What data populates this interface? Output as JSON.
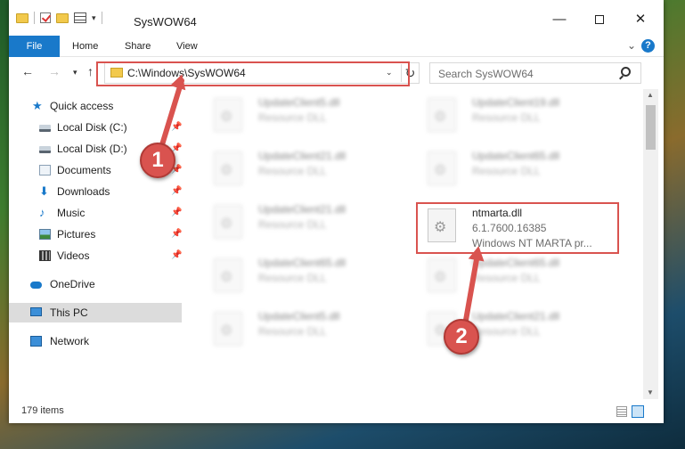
{
  "window": {
    "title": "SysWOW64",
    "controls": {
      "minimize": "—",
      "maximize": "",
      "close": "✕"
    }
  },
  "ribbon": {
    "tabs": [
      "File",
      "Home",
      "Share",
      "View"
    ],
    "help": "?"
  },
  "navigation": {
    "address_path": "C:\\Windows\\SysWOW64",
    "search_placeholder": "Search SysWOW64"
  },
  "sidebar": {
    "items": [
      {
        "label": "Quick access",
        "icon": "star-icon"
      },
      {
        "label": "Local Disk (C:)",
        "icon": "drive-icon",
        "pinned": true
      },
      {
        "label": "Local Disk (D:)",
        "icon": "drive-icon",
        "pinned": true
      },
      {
        "label": "Documents",
        "icon": "documents-icon",
        "pinned": true
      },
      {
        "label": "Downloads",
        "icon": "downloads-icon",
        "pinned": true
      },
      {
        "label": "Music",
        "icon": "music-icon",
        "pinned": true
      },
      {
        "label": "Pictures",
        "icon": "pictures-icon",
        "pinned": true
      },
      {
        "label": "Videos",
        "icon": "videos-icon",
        "pinned": true
      },
      {
        "label": "OneDrive",
        "icon": "onedrive-icon"
      },
      {
        "label": "This PC",
        "icon": "pc-icon",
        "selected": true
      },
      {
        "label": "Network",
        "icon": "network-icon"
      }
    ]
  },
  "files": {
    "left": [
      {
        "name": "UpdateClient5.dll",
        "type": "Resource DLL"
      },
      {
        "name": "UpdateClient21.dll",
        "type": "Resource DLL"
      },
      {
        "name": "UpdateClient21.dll",
        "type": "Resource DLL"
      },
      {
        "name": "UpdateClient65.dll",
        "type": "Resource DLL"
      },
      {
        "name": "UpdateClient5.dll",
        "type": "Resource DLL"
      }
    ],
    "right": [
      {
        "name": "UpdateClient19.dll",
        "type": "Resource DLL"
      },
      {
        "name": "UpdateClient65.dll",
        "type": "Resource DLL"
      },
      {
        "name": "ntmarta.dll",
        "version": "6.1.7600.16385",
        "description": "Windows NT MARTA pr..."
      },
      {
        "name": "UpdateClient65.dll",
        "type": "Resource DLL"
      },
      {
        "name": "UpdateClient21.dll",
        "type": "Resource DLL"
      }
    ]
  },
  "status": {
    "item_count": "179 items"
  },
  "callouts": {
    "first": "1",
    "second": "2"
  },
  "colors": {
    "accent": "#1979ca",
    "highlight": "#d9534f"
  }
}
